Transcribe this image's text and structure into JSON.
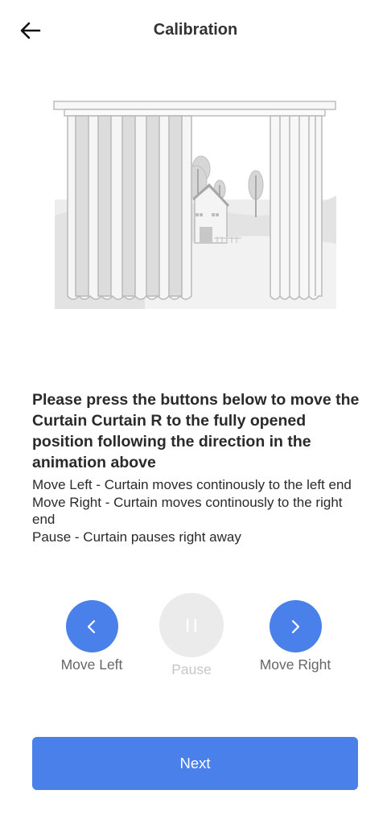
{
  "header": {
    "title": "Calibration",
    "back_icon": "arrow-left-icon"
  },
  "instructions": {
    "heading": "Please press the buttons below to move the Curtain Curtain R to the fully opened position following the direction in the animation above",
    "lines": [
      "Move Left - Curtain moves continously to the left end",
      "Move Right - Curtain moves continously to the right end",
      "Pause - Curtain pauses right away"
    ]
  },
  "controls": {
    "move_left": {
      "label": "Move Left",
      "icon": "chevron-left-icon",
      "enabled": true
    },
    "pause": {
      "label": "Pause",
      "icon": "pause-icon",
      "enabled": false
    },
    "move_right": {
      "label": "Move Right",
      "icon": "chevron-right-icon",
      "enabled": true
    }
  },
  "footer": {
    "next_label": "Next"
  },
  "colors": {
    "accent": "#4a80ea",
    "disabled_bg": "#ebebeb",
    "disabled_text": "#c7c7c7",
    "text": "#2a2a2a",
    "label": "#666666"
  }
}
